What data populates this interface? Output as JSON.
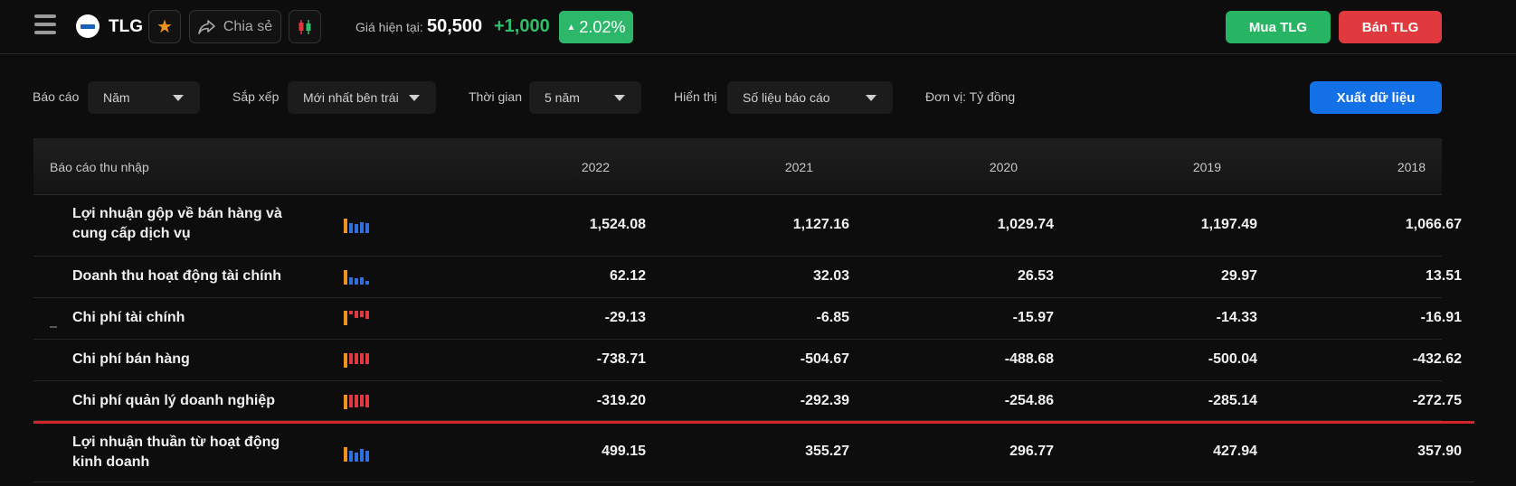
{
  "header": {
    "ticker": "TLG",
    "share_label": "Chia sẻ",
    "price_label": "Giá hiện tại:",
    "price": "50,500",
    "change": "+1,000",
    "change_pct": "2.02%",
    "buy_label": "Mua TLG",
    "sell_label": "Bán TLG",
    "icons": [
      "menu-icon",
      "company-logo",
      "star-icon",
      "share-icon",
      "candlestick-icon"
    ]
  },
  "filters": {
    "report_label": "Báo cáo",
    "report_value": "Năm",
    "sort_label": "Sắp xếp",
    "sort_value": "Mới nhất bên trái",
    "time_label": "Thời gian",
    "time_value": "5 năm",
    "display_label": "Hiển thị",
    "display_value": "Số liệu báo cáo",
    "unit": "Đơn vị: Tỷ đồng",
    "export_label": "Xuất dữ liệu"
  },
  "table": {
    "title": "Báo cáo thu nhập",
    "years": [
      "2022",
      "2021",
      "2020",
      "2019",
      "2018"
    ],
    "rows": [
      {
        "name": "Lợi nhuận gộp về bán hàng và cung cấp dịch vụ",
        "values": [
          "1,524.08",
          "1,127.16",
          "1,029.74",
          "1,197.49",
          "1,066.67"
        ]
      },
      {
        "name": "Doanh thu hoạt động tài chính",
        "values": [
          "62.12",
          "32.03",
          "26.53",
          "29.97",
          "13.51"
        ]
      },
      {
        "name": "Chi phí tài chính",
        "values": [
          "-29.13",
          "-6.85",
          "-15.97",
          "-14.33",
          "-16.91"
        ]
      },
      {
        "name": "Chi phí bán hàng",
        "values": [
          "-738.71",
          "-504.67",
          "-488.68",
          "-500.04",
          "-432.62"
        ]
      },
      {
        "name": "Chi phí quản lý doanh nghiệp",
        "values": [
          "-319.20",
          "-292.39",
          "-254.86",
          "-285.14",
          "-272.75"
        ]
      },
      {
        "name": "Lợi nhuận thuần từ hoạt động kinh doanh",
        "values": [
          "499.15",
          "355.27",
          "296.77",
          "427.94",
          "357.90"
        ]
      }
    ]
  },
  "colors": {
    "positive": "#2fbf6b",
    "buy": "#27b463",
    "sell": "#e0393e",
    "export": "#1470e6",
    "spark_current": "#f0931e",
    "spark_positive": "#2f6fe0",
    "spark_negative": "#e0393e",
    "separator": "#d3262c"
  }
}
